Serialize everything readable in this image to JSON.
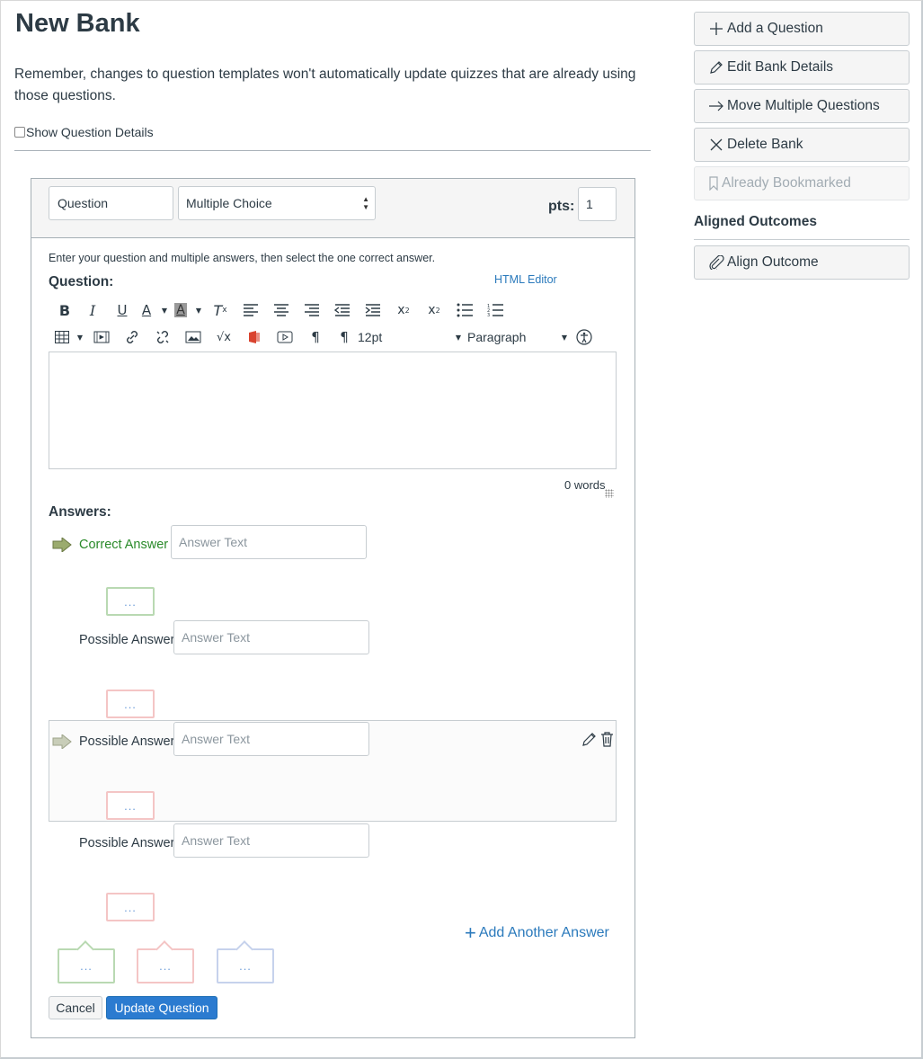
{
  "page": {
    "title": "New Bank",
    "note": "Remember, changes to question templates won't automatically update quizzes that are already using those questions.",
    "show_details_label": "Show Question Details"
  },
  "sidebar": {
    "buttons": [
      {
        "label": "Add a Question",
        "icon": "plus-icon"
      },
      {
        "label": "Edit Bank Details",
        "icon": "pencil-icon"
      },
      {
        "label": "Move Multiple Questions",
        "icon": "arrow-right-icon"
      },
      {
        "label": "Delete Bank",
        "icon": "x-icon"
      },
      {
        "label": "Already Bookmarked",
        "icon": "bookmark-icon",
        "disabled": true
      }
    ],
    "aligned_heading": "Aligned Outcomes",
    "align_button": {
      "label": "Align Outcome",
      "icon": "paperclip-icon"
    }
  },
  "question": {
    "name_value": "Question",
    "type_value": "Multiple Choice",
    "pts_label": "pts:",
    "pts_value": "1",
    "instructions": "Enter your question and multiple answers, then select the one correct answer.",
    "question_label": "Question:",
    "html_editor_link": "HTML Editor",
    "font_size": "12pt",
    "block_format": "Paragraph",
    "word_count": "0 words"
  },
  "answers": {
    "label": "Answers:",
    "items": [
      {
        "label": "Correct Answer",
        "placeholder": "Answer Text",
        "correct": true
      },
      {
        "label": "Possible Answer",
        "placeholder": "Answer Text",
        "correct": false
      },
      {
        "label": "Possible Answer",
        "placeholder": "Answer Text",
        "correct": false
      },
      {
        "label": "Possible Answer",
        "placeholder": "Answer Text",
        "correct": false
      }
    ],
    "comment_placeholder": "...",
    "add_another": "Add Another Answer"
  },
  "general_comments": [
    "...",
    "...",
    "..."
  ],
  "actions": {
    "cancel": "Cancel",
    "update": "Update Question"
  },
  "colors": {
    "link": "#2b7abc",
    "primary": "#2b7bd0",
    "correct": "#2a8a2a",
    "correct_border": "#b9d9b2",
    "incorrect_border": "#f4c5c5",
    "neutral_border": "#c6d2ec"
  }
}
